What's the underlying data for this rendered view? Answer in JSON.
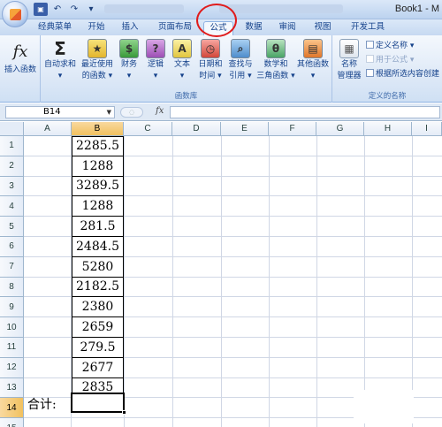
{
  "window": {
    "title": "Book1 - M"
  },
  "ribbon_tabs": [
    {
      "label": "经典菜单",
      "active": false
    },
    {
      "label": "开始",
      "active": false
    },
    {
      "label": "插入",
      "active": false
    },
    {
      "label": "页面布局",
      "active": false
    },
    {
      "label": "公式",
      "active": true
    },
    {
      "label": "数据",
      "active": false
    },
    {
      "label": "审阅",
      "active": false
    },
    {
      "label": "视图",
      "active": false
    },
    {
      "label": "开发工具",
      "active": false
    }
  ],
  "ribbon": {
    "insert_function": {
      "line1": "插入函数",
      "icon": "fx"
    },
    "library": {
      "group_label": "函数库",
      "buttons": [
        {
          "line1": "自动求和",
          "line2": "▾",
          "icon": "Σ"
        },
        {
          "line1": "最近使用",
          "line2": "的函数 ▾"
        },
        {
          "line1": "财务",
          "line2": "▾"
        },
        {
          "line1": "逻辑",
          "line2": "▾"
        },
        {
          "line1": "文本",
          "line2": "▾",
          "icon": "A"
        },
        {
          "line1": "日期和",
          "line2": "时间 ▾"
        },
        {
          "line1": "查找与",
          "line2": "引用 ▾"
        },
        {
          "line1": "数学和",
          "line2": "三角函数 ▾",
          "icon": "θ"
        },
        {
          "line1": "其他函数",
          "line2": "▾"
        }
      ]
    },
    "names": {
      "group_label": "定义的名称",
      "manager_line1": "名称",
      "manager_line2": "管理器",
      "define_name": "定义名称 ▾",
      "use_in_formula": "用于公式 ▾",
      "create_from_selection": "根据所选内容创建"
    }
  },
  "formula_bar": {
    "name_box": "B14",
    "fx_label": "fx",
    "formula": ""
  },
  "columns": [
    "A",
    "B",
    "C",
    "D",
    "E",
    "F",
    "G",
    "H",
    "I"
  ],
  "rows": [
    "1",
    "2",
    "3",
    "4",
    "5",
    "6",
    "7",
    "8",
    "9",
    "10",
    "11",
    "12",
    "13",
    "14",
    "15"
  ],
  "column_b_values": [
    "2285.5",
    "1288",
    "3289.5",
    "1288",
    "281.5",
    "2484.5",
    "5280",
    "2182.5",
    "2380",
    "2659",
    "279.5",
    "2677",
    "2835"
  ],
  "row14_label": "合计:",
  "active_cell": "B14"
}
